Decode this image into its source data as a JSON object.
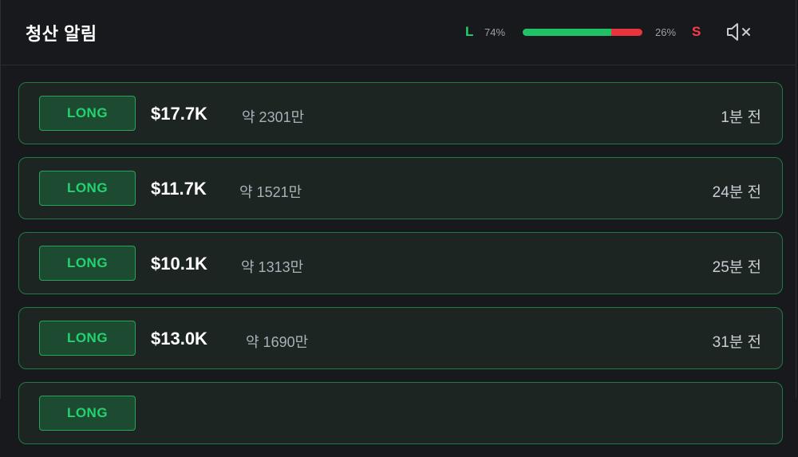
{
  "header": {
    "title": "청산 알림",
    "long_letter": "L",
    "long_pct": "74%",
    "short_pct": "26%",
    "short_letter": "S",
    "long_ratio": 0.74,
    "mute_icon": "speaker-muted-icon"
  },
  "colors": {
    "long": "#1fc265",
    "short": "#e8343d",
    "background": "#17191d"
  },
  "alerts": [
    {
      "side": "LONG",
      "amount": "$17.7K",
      "krw": "약 2301만",
      "time": "1분 전"
    },
    {
      "side": "LONG",
      "amount": "$11.7K",
      "krw": "약 1521만",
      "time": "24분 전"
    },
    {
      "side": "LONG",
      "amount": "$10.1K",
      "krw": "약 1313만",
      "time": "25분 전"
    },
    {
      "side": "LONG",
      "amount": "$13.0K",
      "krw": "약 1690만",
      "time": "31분 전"
    },
    {
      "side": "LONG",
      "amount": "",
      "krw": "",
      "time": ""
    }
  ]
}
